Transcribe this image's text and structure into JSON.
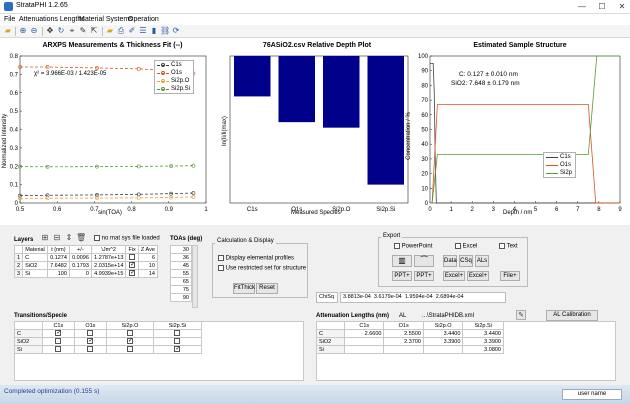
{
  "window": {
    "title": "StrataPHI 1.2.65",
    "minimize": "—",
    "maximize": "☐",
    "close": "✕"
  },
  "menu": [
    "File",
    "Attenuations Lengths",
    "Material Systems",
    "Operation"
  ],
  "toolbar_icons": [
    "open-folder-icon",
    "save-icon",
    "zoom-in-icon",
    "zoom-out-icon",
    "pan-icon",
    "rotate-icon",
    "folder-icon",
    "print-icon",
    "edit-icon",
    "cursor-icon",
    "datatip-icon",
    "brush-icon",
    "legend-icon",
    "colorbar-icon",
    "link-icon",
    "refresh-icon"
  ],
  "chart_data": [
    {
      "type": "scatter",
      "title": "ARXPS Measurements & Thickness Fit (--)",
      "xlabel": "sin(TOA)",
      "ylabel": "Normalized Intensity",
      "xlim": [
        0.5,
        1.0
      ],
      "ylim": [
        0,
        0.8
      ],
      "xticks": [
        "0.5",
        "0.6",
        "0.7",
        "0.8",
        "0.9",
        "1"
      ],
      "yticks": [
        "0",
        "0.1",
        "0.2",
        "0.3",
        "0.4",
        "0.5",
        "0.6",
        "0.7",
        "0.8"
      ],
      "annotation": "χ² = 3.966E-03 / 1.423E-05",
      "grid": false,
      "legend_position": "top-right",
      "x": [
        0.5,
        0.574,
        0.707,
        0.819,
        0.906,
        0.966
      ],
      "series": [
        {
          "name": "C1s",
          "color": "#404040",
          "values": [
            0.04,
            0.042,
            0.044,
            0.047,
            0.051,
            0.054
          ]
        },
        {
          "name": "O1s",
          "color": "#d9531e",
          "values": [
            0.74,
            0.74,
            0.735,
            0.73,
            0.72,
            0.705
          ]
        },
        {
          "name": "Si2p.O",
          "color": "#e8a23a",
          "values": [
            0.025,
            0.026,
            0.027,
            0.028,
            0.03,
            0.033
          ]
        },
        {
          "name": "Si2p.Si",
          "color": "#5a9a3a",
          "values": [
            0.198,
            0.197,
            0.198,
            0.199,
            0.201,
            0.203
          ]
        }
      ]
    },
    {
      "type": "bar",
      "title": "76ASiO2.csv Relative Depth Plot",
      "xlabel": "Measured Species",
      "ylabel": "ln(Ii/Ii(max)",
      "categories": [
        "C1s",
        "O1s",
        "Si2p.O",
        "Si2p.Si"
      ],
      "values": [
        -0.011,
        -0.018,
        -0.0195,
        -0.035
      ],
      "ylim": [
        -0.04,
        0
      ],
      "color": "#00008b"
    },
    {
      "type": "line",
      "title": "Estimated Sample Structure",
      "xlabel": "Depth / nm",
      "ylabel": "Concentration / %",
      "xlim": [
        0,
        9
      ],
      "ylim": [
        0,
        100
      ],
      "xticks": [
        "0",
        "1",
        "2",
        "3",
        "4",
        "5",
        "6",
        "7",
        "8",
        "9"
      ],
      "yticks": [
        "0",
        "10",
        "20",
        "30",
        "40",
        "50",
        "60",
        "70",
        "80",
        "90",
        "100"
      ],
      "annotations": [
        "C: 0.127 ± 0.010 nm",
        "SiO2: 7.648 ± 0.179 nm"
      ],
      "legend_position": "bottom-right",
      "series": [
        {
          "name": "C1s",
          "color": "#404040"
        },
        {
          "name": "O1s",
          "color": "#d9531e"
        },
        {
          "name": "Si2p",
          "color": "#5a9a3a"
        }
      ]
    }
  ],
  "layers": {
    "title": "Layers",
    "no_mat_sys_label": "no mat sys file loaded",
    "columns": [
      "",
      "Material",
      "t (nm)",
      "+/-",
      "\\Jm^2",
      "Fix",
      "Z Ave"
    ],
    "rows": [
      {
        "n": "1",
        "material": "C",
        "t": "0.1274",
        "pm": "0.0096",
        "jm": "1.2787e+13",
        "fix": false,
        "z": "6"
      },
      {
        "n": "2",
        "material": "SiO2",
        "t": "7.6482",
        "pm": "0.1793",
        "jm": "2.0315e+14",
        "fix": true,
        "z": "10"
      },
      {
        "n": "3",
        "material": "Si",
        "t": "100",
        "pm": "0",
        "jm": "4.9939e+15",
        "fix": true,
        "z": "14"
      }
    ]
  },
  "toas": {
    "title": "TOAs (deg)",
    "values": [
      "30",
      "36",
      "45",
      "55",
      "65",
      "75",
      "90"
    ]
  },
  "calc": {
    "title": "Calculation & Display",
    "display_elemental": "Display elemental profiles",
    "use_restricted": "Use restricted set for structure",
    "fit_button": "FitThick",
    "reset_button": "Reset"
  },
  "export": {
    "title": "Export",
    "powerpoint": "PowerPoint",
    "excel": "Excel",
    "text": "Text",
    "ppt1": "PPT+",
    "ppt2": "PPT+",
    "data": "Data",
    "csq": "CSq",
    "als": "ALs",
    "excel1": "Excel+",
    "excel2": "Excel+",
    "file": "File+"
  },
  "chisq": {
    "label": "ChiSq",
    "values": [
      "3.8813e-04",
      "3.6179e-04",
      "1.9594e-04",
      "2.6894e-04"
    ]
  },
  "transitions": {
    "title": "Transitions/Specie",
    "columns": [
      "",
      "C1s",
      "O1s",
      "Si2p.O",
      "Si2p.Si"
    ],
    "rows": [
      {
        "name": "C",
        "checks": [
          true,
          false,
          false,
          false
        ]
      },
      {
        "name": "SiO2",
        "checks": [
          false,
          true,
          true,
          false
        ]
      },
      {
        "name": "Si",
        "checks": [
          false,
          false,
          false,
          true
        ]
      }
    ]
  },
  "attenuation": {
    "title": "Attenuation Lengths (nm)",
    "al_label": "AL",
    "file": "...\\StrataPHIDB.xml",
    "calibration_button": "AL Calibration",
    "columns": [
      "",
      "C1s",
      "O1s",
      "Si2p.O",
      "Si2p.Si"
    ],
    "rows": [
      {
        "name": "C",
        "vals": [
          "2.6600",
          "2.5500",
          "3.4400",
          "3.4400"
        ]
      },
      {
        "name": "SiO2",
        "vals": [
          "",
          "2.3700",
          "3.3900",
          "3.3900"
        ]
      },
      {
        "name": "Si",
        "vals": [
          "",
          "",
          "",
          "3.0800"
        ]
      }
    ]
  },
  "status": {
    "text": "Completed optimization (0.155 s)",
    "user": "user name"
  }
}
